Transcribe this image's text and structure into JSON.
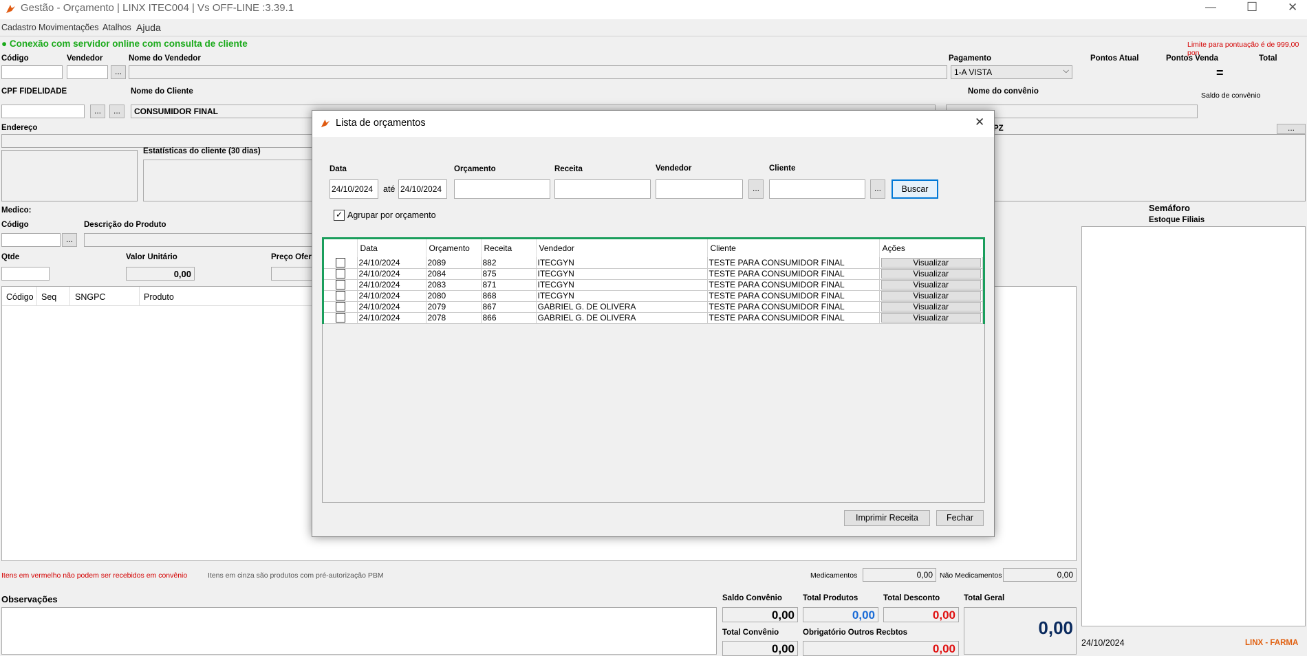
{
  "window": {
    "title": "Gestão - Orçamento  | LINX ITEC004 | Vs OFF-LINE :3.39.1",
    "minimize": "—",
    "maximize": "☐",
    "close": "✕"
  },
  "menu": [
    "Cadastro",
    "Movimentações",
    "Atalhos",
    "Ajuda"
  ],
  "status": {
    "connection": "● Conexão com servidor online com consulta de cliente",
    "limit": "Limite para pontuação é de 999,00 pon"
  },
  "form": {
    "codigo_label": "Código",
    "vendedor_label": "Vendedor",
    "nome_vendedor_label": "Nome do Vendedor",
    "pagamento_label": "Pagamento",
    "pagamento_value": "1-A VISTA",
    "pontos_atual_label": "Pontos Atual",
    "pontos_venda_label": "Pontos Venda",
    "total_label": "Total",
    "equals": "=",
    "cpf_label": "CPF FIDELIDADE",
    "nome_cliente_label": "Nome do Cliente",
    "nome_cliente_value": "CONSUMIDOR FINAL",
    "nome_convenio_label": "Nome do convênio",
    "saldo_convenio_label": "Saldo de convênio",
    "endereco_label": "Endereço",
    "pz_fragment": "PZ",
    "estatisticas_label": "Estatísticas do cliente  (30 dias)",
    "medico_label": "Medico:",
    "codigo2_label": "Código",
    "descricao_label": "Descrição do Produto",
    "semaforo_label": "Semáforo",
    "estoque_label": "Estoque Filiais",
    "qtde_label": "Qtde",
    "valor_unitario_label": "Valor Unitário",
    "valor_unitario_value": "0,00",
    "preco_oferta_label": "Preço Ofer",
    "dots": "..."
  },
  "product_grid": {
    "columns": [
      "Código",
      "Seq",
      "SNGPC",
      "Produto"
    ]
  },
  "footer": {
    "red_note": "Itens em vermelho não podem ser recebidos em convênio",
    "gray_note": "Itens em cinza são produtos com pré-autorização PBM",
    "medicamentos_label": "Medicamentos",
    "medicamentos_value": "0,00",
    "nao_medicamentos_label": "Não Medicamentos",
    "nao_medicamentos_value": "0,00",
    "observacoes_label": "Observações",
    "saldo_convenio_label": "Saldo Convênio",
    "saldo_convenio_value": "0,00",
    "total_produtos_label": "Total Produtos",
    "total_produtos_value": "0,00",
    "total_desconto_label": "Total Desconto",
    "total_desconto_value": "0,00",
    "total_geral_label": "Total Geral",
    "total_geral_value": "0,00",
    "total_convenio_label": "Total Convênio",
    "total_convenio_value": "0,00",
    "obrigatorio_label": "Obrigatório Outros Recbtos",
    "obrigatorio_value": "0,00",
    "date": "24/10/2024",
    "brand": "LINX - FARMA"
  },
  "dialog": {
    "title": "Lista de orçamentos",
    "close": "✕",
    "data_label": "Data",
    "date_from": "24/10/2024",
    "ate_label": "até",
    "date_to": "24/10/2024",
    "orcamento_label": "Orçamento",
    "receita_label": "Receita",
    "vendedor_label": "Vendedor",
    "cliente_label": "Cliente",
    "dots": "...",
    "buscar": "Buscar",
    "agrupar_label": "Agrupar por orçamento",
    "agrupar_checked": "✓",
    "columns": [
      "Data",
      "Orçamento",
      "Receita",
      "Vendedor",
      "Cliente",
      "Ações"
    ],
    "rows": [
      {
        "data": "24/10/2024",
        "orcamento": "2089",
        "receita": "882",
        "vendedor": "ITECGYN",
        "cliente": "TESTE PARA CONSUMIDOR FINAL",
        "acao": "Visualizar"
      },
      {
        "data": "24/10/2024",
        "orcamento": "2084",
        "receita": "875",
        "vendedor": "ITECGYN",
        "cliente": "TESTE PARA CONSUMIDOR FINAL",
        "acao": "Visualizar"
      },
      {
        "data": "24/10/2024",
        "orcamento": "2083",
        "receita": "871",
        "vendedor": "ITECGYN",
        "cliente": "TESTE PARA CONSUMIDOR FINAL",
        "acao": "Visualizar"
      },
      {
        "data": "24/10/2024",
        "orcamento": "2080",
        "receita": "868",
        "vendedor": "ITECGYN",
        "cliente": "TESTE PARA CONSUMIDOR FINAL",
        "acao": "Visualizar"
      },
      {
        "data": "24/10/2024",
        "orcamento": "2079",
        "receita": "867",
        "vendedor": "GABRIEL G. DE OLIVERA",
        "cliente": "TESTE PARA CONSUMIDOR FINAL",
        "acao": "Visualizar"
      },
      {
        "data": "24/10/2024",
        "orcamento": "2078",
        "receita": "866",
        "vendedor": "GABRIEL G. DE OLIVERA",
        "cliente": "TESTE PARA CONSUMIDOR FINAL",
        "acao": "Visualizar"
      }
    ],
    "imprimir": "Imprimir Receita",
    "fechar": "Fechar"
  },
  "colors": {
    "status_green": "#1aaa1a",
    "limit_red": "#d40000",
    "highlight_green": "#1a9e5c",
    "value_blue": "#1a6bd6",
    "value_red": "#e01010",
    "total_navy": "#0a2a5e",
    "brand_orange": "#e06010",
    "logo_orange": "#e05a10"
  }
}
